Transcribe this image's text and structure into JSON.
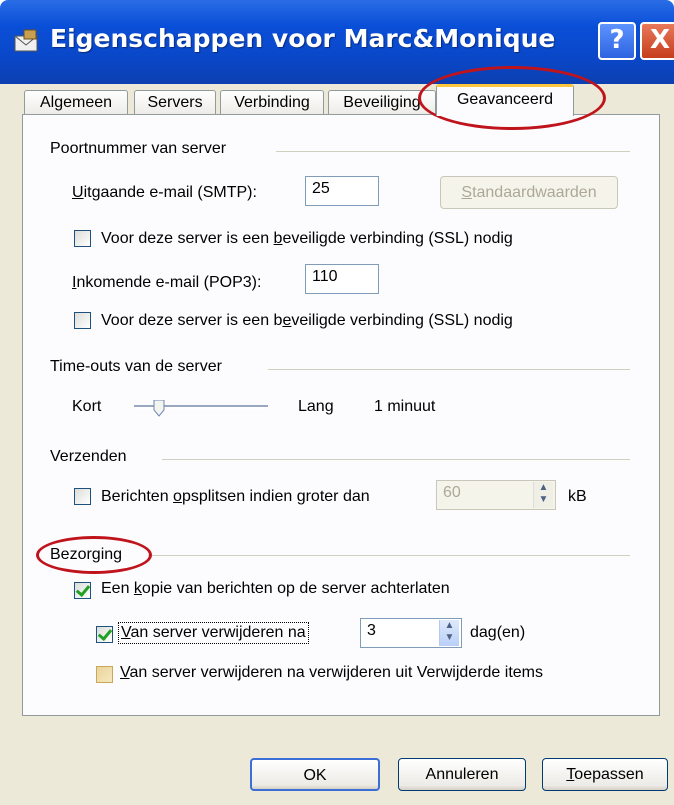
{
  "window": {
    "title": "Eigenschappen voor Marc&Monique",
    "help_label": "?",
    "close_label": "X"
  },
  "tabs": [
    {
      "label": "Algemeen",
      "active": false
    },
    {
      "label": "Servers",
      "active": false
    },
    {
      "label": "Verbinding",
      "active": false
    },
    {
      "label": "Beveiliging",
      "active": false
    },
    {
      "label": "Geavanceerd",
      "active": true
    }
  ],
  "server_ports": {
    "group_label": "Poortnummer van server",
    "smtp_label_u": "U",
    "smtp_label_rest": "itgaande e-mail (SMTP):",
    "smtp_value": "25",
    "defaults_button_u": "S",
    "defaults_button_rest": "tandaardwaarden",
    "ssl_smtp_pre": "Voor deze server is een ",
    "ssl_smtp_u": "b",
    "ssl_smtp_post": "eveiligde verbinding (SSL) nodig",
    "pop3_label_u": "I",
    "pop3_label_rest": "nkomende e-mail (POP3):",
    "pop3_value": "110",
    "ssl_pop3_pre": "Voor deze server is een b",
    "ssl_pop3_u": "e",
    "ssl_pop3_post": "veiligde verbinding (SSL) nodig"
  },
  "timeouts": {
    "group_label": "Time-outs van de server",
    "short_label": "Kort",
    "long_label": "Lang",
    "value_text": "1 minuut",
    "slider_level": 0.25
  },
  "sending": {
    "group_label": "Verzenden",
    "split_pre": "Berichten ",
    "split_u": "o",
    "split_post": "psplitsen indien groter dan",
    "split_value": "60",
    "unit": "kB"
  },
  "delivery": {
    "group_label": "Bezorging",
    "keep_copy_pre": "Een ",
    "keep_copy_u": "k",
    "keep_copy_post": "opie van berichten op de server achterlaten",
    "remove_after_u": "V",
    "remove_after_rest": "an server verwijderen na",
    "remove_after_value": "3",
    "remove_after_unit": "dag(en)",
    "remove_deleted_u": "V",
    "remove_deleted_rest": "an server verwijderen na verwijderen uit Verwijderde items"
  },
  "buttons": {
    "ok": "OK",
    "cancel": "Annuleren",
    "apply_u": "T",
    "apply_rest": "oepassen"
  },
  "colors": {
    "titlebar": "#0a4fd8",
    "annotation": "#c0141c",
    "dialog": "#ece9d8"
  }
}
